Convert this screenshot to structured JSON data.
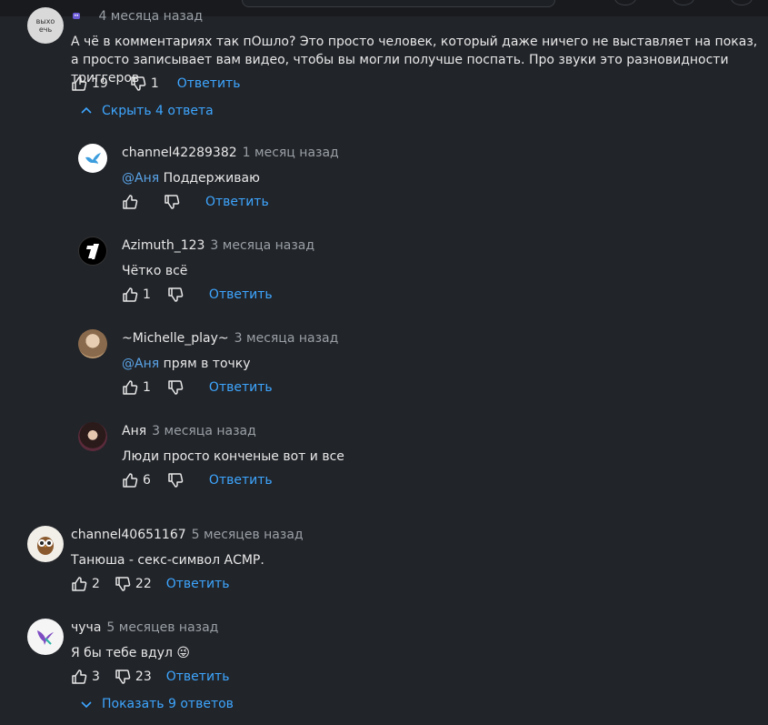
{
  "top": {
    "time": "4 месяца назад",
    "text": "А чё в комментариях так пОшло? Это просто человек, который даже ничего не выставляет на показ, а просто записывает вам видео, чтобы вы могли получше поспать. Про звуки это разновидности триггеров",
    "likes": "19",
    "dislikes": "1",
    "reply": "Ответить",
    "hide_replies": "Скрыть 4 ответа",
    "avatar_text": "выхо ечь"
  },
  "replies": [
    {
      "author": "channel42289382",
      "time": "1 месяц назад",
      "mention": "@Аня",
      "text": "Поддерживаю",
      "likes": "",
      "reply": "Ответить"
    },
    {
      "author": "Azimuth_123",
      "time": "3 месяца назад",
      "mention": "",
      "text": "Чётко всё",
      "likes": "1",
      "reply": "Ответить"
    },
    {
      "author": "~Michelle_play~",
      "time": "3 месяца назад",
      "mention": "@Аня",
      "text": "прям в точку",
      "likes": "1",
      "reply": "Ответить"
    },
    {
      "author": "Аня",
      "time": "3 месяца назад",
      "mention": "",
      "text": "Люди просто конченые вот и все",
      "likes": "6",
      "reply": "Ответить"
    }
  ],
  "comments": [
    {
      "author": "channel40651167",
      "time": "5 месяцев назад",
      "text": "Танюша - секс-символ АСМР.",
      "likes": "2",
      "dislikes": "22",
      "reply": "Ответить"
    },
    {
      "author": "чуча",
      "time": "5 месяцев назад",
      "text": "Я бы тебе вдул",
      "emoji": "😜",
      "likes": "3",
      "dislikes": "23",
      "reply": "Ответить"
    }
  ],
  "show_replies": "Показать 9 ответов",
  "colors": {
    "background": "#212429",
    "link": "#3ea6ff",
    "mention": "#5aa4e8",
    "muted": "#9aa0a6"
  }
}
